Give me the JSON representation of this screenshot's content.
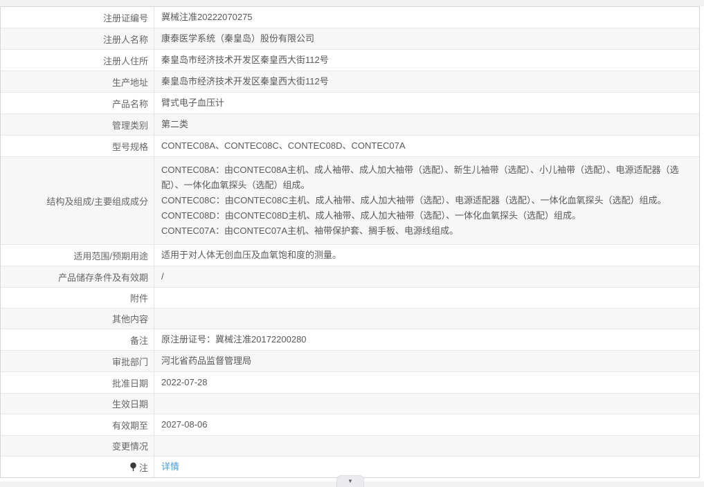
{
  "colors": {
    "stripe_row_bg": "#f7f7f7",
    "border": "#e8e8e8",
    "label_text": "#666666",
    "value_text": "#595959",
    "link_blue": "#4a9ada"
  },
  "page": {
    "collapse_icon": "▼"
  },
  "table": {
    "rows": [
      {
        "label": "注册证编号",
        "value": "冀械注准20222070275"
      },
      {
        "label": "注册人名称",
        "value": "康泰医学系统（秦皇岛）股份有限公司"
      },
      {
        "label": "注册人住所",
        "value": "秦皇岛市经济技术开发区秦皇西大街112号"
      },
      {
        "label": "生产地址",
        "value": "秦皇岛市经济技术开发区秦皇西大街112号"
      },
      {
        "label": "产品名称",
        "value": "臂式电子血压计"
      },
      {
        "label": "管理类别",
        "value": "第二类"
      },
      {
        "label": "型号规格",
        "value": "CONTEC08A、CONTEC08C、CONTEC08D、CONTEC07A"
      },
      {
        "label": "结构及组成/主要组成成分",
        "value": "CONTEC08A：由CONTEC08A主机、成人袖带、成人加大袖带（选配）、新生儿袖带（选配）、小儿袖带（选配）、电源适配器（选配）、一体化血氧探头（选配）组成。\nCONTEC08C：由CONTEC08C主机、成人袖带、成人加大袖带（选配）、电源适配器（选配）、一体化血氧探头（选配）组成。\nCONTEC08D：由CONTEC08D主机、成人袖带、成人加大袖带（选配）、一体化血氧探头（选配）组成。\nCONTEC07A：由CONTEC07A主机、袖带保护套、搁手板、电源线组成。",
        "multiline": true
      },
      {
        "label": "适用范围/预期用途",
        "value": "适用于对人体无创血压及血氧饱和度的测量。"
      },
      {
        "label": "产品储存条件及有效期",
        "value": "/"
      },
      {
        "label": "附件",
        "value": ""
      },
      {
        "label": "其他内容",
        "value": ""
      },
      {
        "label": "备注",
        "value": "原注册证号：冀械注准20172200280"
      },
      {
        "label": "审批部门",
        "value": "河北省药品监督管理局"
      },
      {
        "label": "批准日期",
        "value": "2022-07-28"
      },
      {
        "label": "生效日期",
        "value": ""
      },
      {
        "label": "有效期至",
        "value": "2027-08-06"
      },
      {
        "label": "变更情况",
        "value": ""
      },
      {
        "label": "注",
        "value": "详情",
        "link": true,
        "icon": "pin"
      }
    ]
  }
}
